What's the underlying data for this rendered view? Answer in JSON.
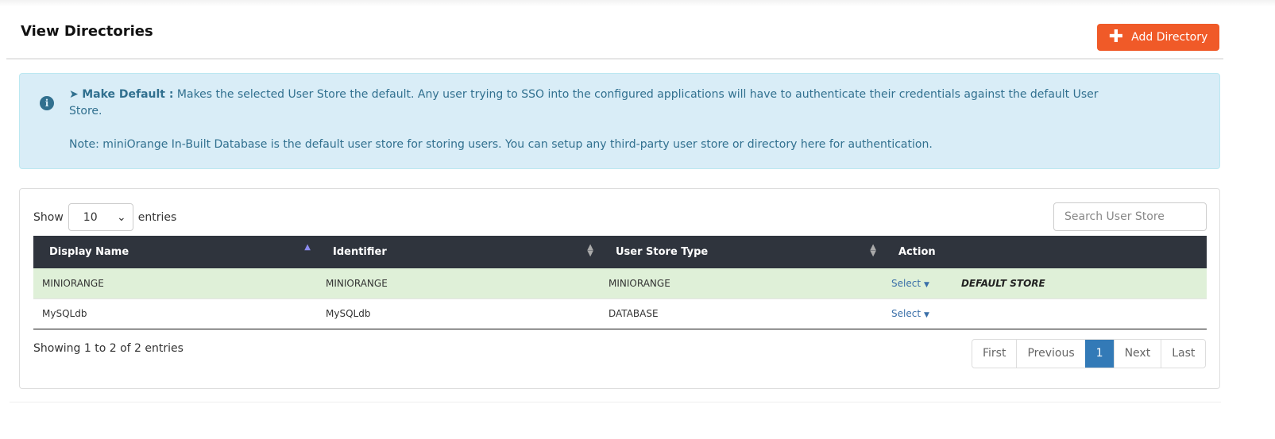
{
  "header": {
    "title": "View Directories",
    "add_button": "Add Directory"
  },
  "alert": {
    "label": "Make Default :",
    "text": " Makes the selected User Store the default. Any user trying to SSO into the configured applications will have to authenticate their credentials against the default User Store.",
    "note": "Note: miniOrange In-Built Database is the default user store for storing users. You can setup any third-party user store or directory here for authentication."
  },
  "table_controls": {
    "show": "Show",
    "entries_value": "10",
    "entries": "entries",
    "search_placeholder": "Search User Store"
  },
  "columns": [
    "Display Name",
    "Identifier",
    "User Store Type",
    "Action"
  ],
  "rows": [
    {
      "display_name": "MINIORANGE",
      "identifier": "MINIORANGE",
      "type": "MINIORANGE",
      "action": "Select",
      "badge": "DEFAULT STORE"
    },
    {
      "display_name": "MySQLdb",
      "identifier": "MySQLdb",
      "type": "DATABASE",
      "action": "Select"
    }
  ],
  "footer": {
    "info": "Showing 1 to 2 of 2 entries",
    "pager": [
      "First",
      "Previous",
      "1",
      "Next",
      "Last"
    ],
    "current_page": 1
  },
  "colors": {
    "accent": "#f05a28",
    "alert_bg": "#d9edf7",
    "header_bg": "#2f343d",
    "default_row": "#dff0d8",
    "active_page": "#337ab7"
  }
}
